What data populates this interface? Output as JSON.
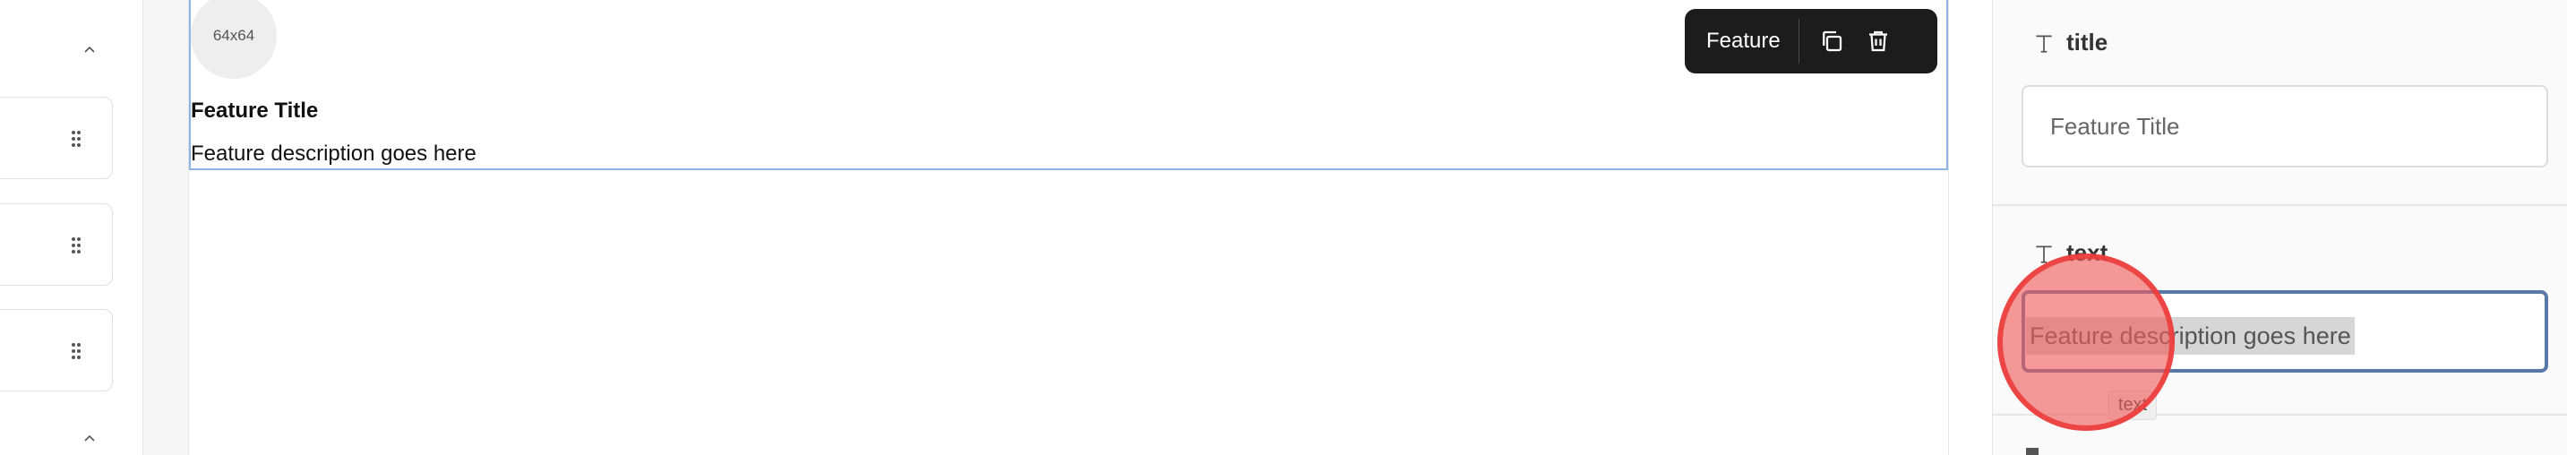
{
  "canvas": {
    "image_placeholder": "64x64",
    "feature": {
      "title": "Feature Title",
      "description": "Feature description goes here"
    },
    "toolbar": {
      "label": "Feature",
      "icons": [
        "copy-icon",
        "trash-icon"
      ]
    }
  },
  "left_panel": {
    "icons": [
      "chevron-up-icon",
      "drag-handle-icon",
      "drag-handle-icon",
      "drag-handle-icon",
      "chevron-up-icon"
    ]
  },
  "properties": {
    "title_field": {
      "label": "title",
      "value": "Feature Title"
    },
    "text_field": {
      "label": "text",
      "value": "Feature description goes here",
      "tooltip": "text"
    }
  },
  "colors": {
    "selection_border": "#8fb3e3",
    "toolbar_bg": "#1c1c1c",
    "focused_input_border": "#5879a8",
    "click_indicator": "#ec3c3c"
  }
}
